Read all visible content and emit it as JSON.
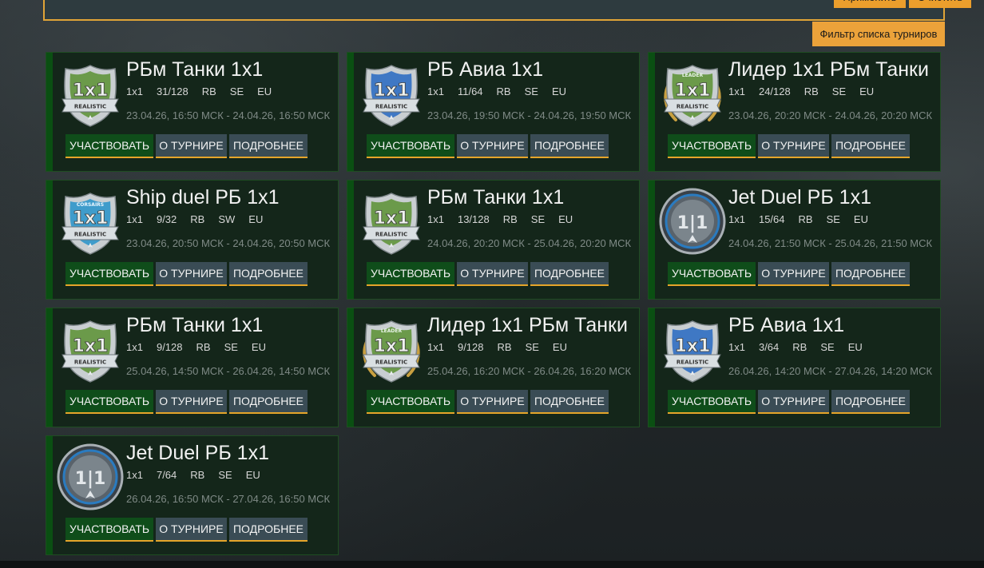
{
  "filter": {
    "apply_label": "Применить",
    "clear_label": "Очистить",
    "tab_label": "Фильтр списка турниров"
  },
  "buttons": {
    "join": "УЧАСТВОВАТЬ",
    "about": "О ТУРНИРЕ",
    "more": "ПОДРОБНЕЕ"
  },
  "colors": {
    "accent_orange": "#eb9e2c",
    "card_bg": "#14261a",
    "join_green": "#0f4d1a",
    "secondary_button": "#3a4c55"
  },
  "tournaments": [
    {
      "title": "РБм Танки 1x1",
      "mode": "1x1",
      "slots": "31/128",
      "difficulty": "RB",
      "type": "SE",
      "region": "EU",
      "dates": "23.04.26, 16:50 МСК - 24.04.26, 16:50 МСК",
      "icon": "tank-realistic-badge-icon"
    },
    {
      "title": "РБ Авиа 1x1",
      "mode": "1x1",
      "slots": "11/64",
      "difficulty": "RB",
      "type": "SE",
      "region": "EU",
      "dates": "23.04.26, 19:50 МСК - 24.04.26, 19:50 МСК",
      "icon": "air-realistic-badge-icon"
    },
    {
      "title": "Лидер 1x1 РБм Танки",
      "mode": "1x1",
      "slots": "24/128",
      "difficulty": "RB",
      "type": "SE",
      "region": "EU",
      "dates": "23.04.26, 20:20 МСК - 24.04.26, 20:20 МСК",
      "icon": "leader-tank-badge-icon"
    },
    {
      "title": "Ship duel РБ 1x1",
      "mode": "1x1",
      "slots": "9/32",
      "difficulty": "RB",
      "type": "SW",
      "region": "EU",
      "dates": "23.04.26, 20:50 МСК - 24.04.26, 20:50 МСК",
      "icon": "corsairs-ship-badge-icon"
    },
    {
      "title": "РБм Танки 1x1",
      "mode": "1x1",
      "slots": "13/128",
      "difficulty": "RB",
      "type": "SE",
      "region": "EU",
      "dates": "24.04.26, 20:20 МСК - 25.04.26, 20:20 МСК",
      "icon": "tank-realistic-badge-icon"
    },
    {
      "title": "Jet Duel РБ 1x1",
      "mode": "1x1",
      "slots": "15/64",
      "difficulty": "RB",
      "type": "SE",
      "region": "EU",
      "dates": "24.04.26, 21:50 МСК - 25.04.26, 21:50 МСК",
      "icon": "jet-duel-badge-icon"
    },
    {
      "title": "РБм Танки 1x1",
      "mode": "1x1",
      "slots": "9/128",
      "difficulty": "RB",
      "type": "SE",
      "region": "EU",
      "dates": "25.04.26, 14:50 МСК - 26.04.26, 14:50 МСК",
      "icon": "tank-realistic-badge-icon"
    },
    {
      "title": "Лидер 1x1 РБм Танки",
      "mode": "1x1",
      "slots": "9/128",
      "difficulty": "RB",
      "type": "SE",
      "region": "EU",
      "dates": "25.04.26, 16:20 МСК - 26.04.26, 16:20 МСК",
      "icon": "leader-tank-badge-icon"
    },
    {
      "title": "РБ Авиа 1x1",
      "mode": "1x1",
      "slots": "3/64",
      "difficulty": "RB",
      "type": "SE",
      "region": "EU",
      "dates": "26.04.26, 14:20 МСК - 27.04.26, 14:20 МСК",
      "icon": "air-realistic-badge-icon"
    },
    {
      "title": "Jet Duel РБ 1x1",
      "mode": "1x1",
      "slots": "7/64",
      "difficulty": "RB",
      "type": "SE",
      "region": "EU",
      "dates": "26.04.26, 16:50 МСК - 27.04.26, 16:50 МСК",
      "icon": "jet-duel-badge-icon"
    }
  ]
}
